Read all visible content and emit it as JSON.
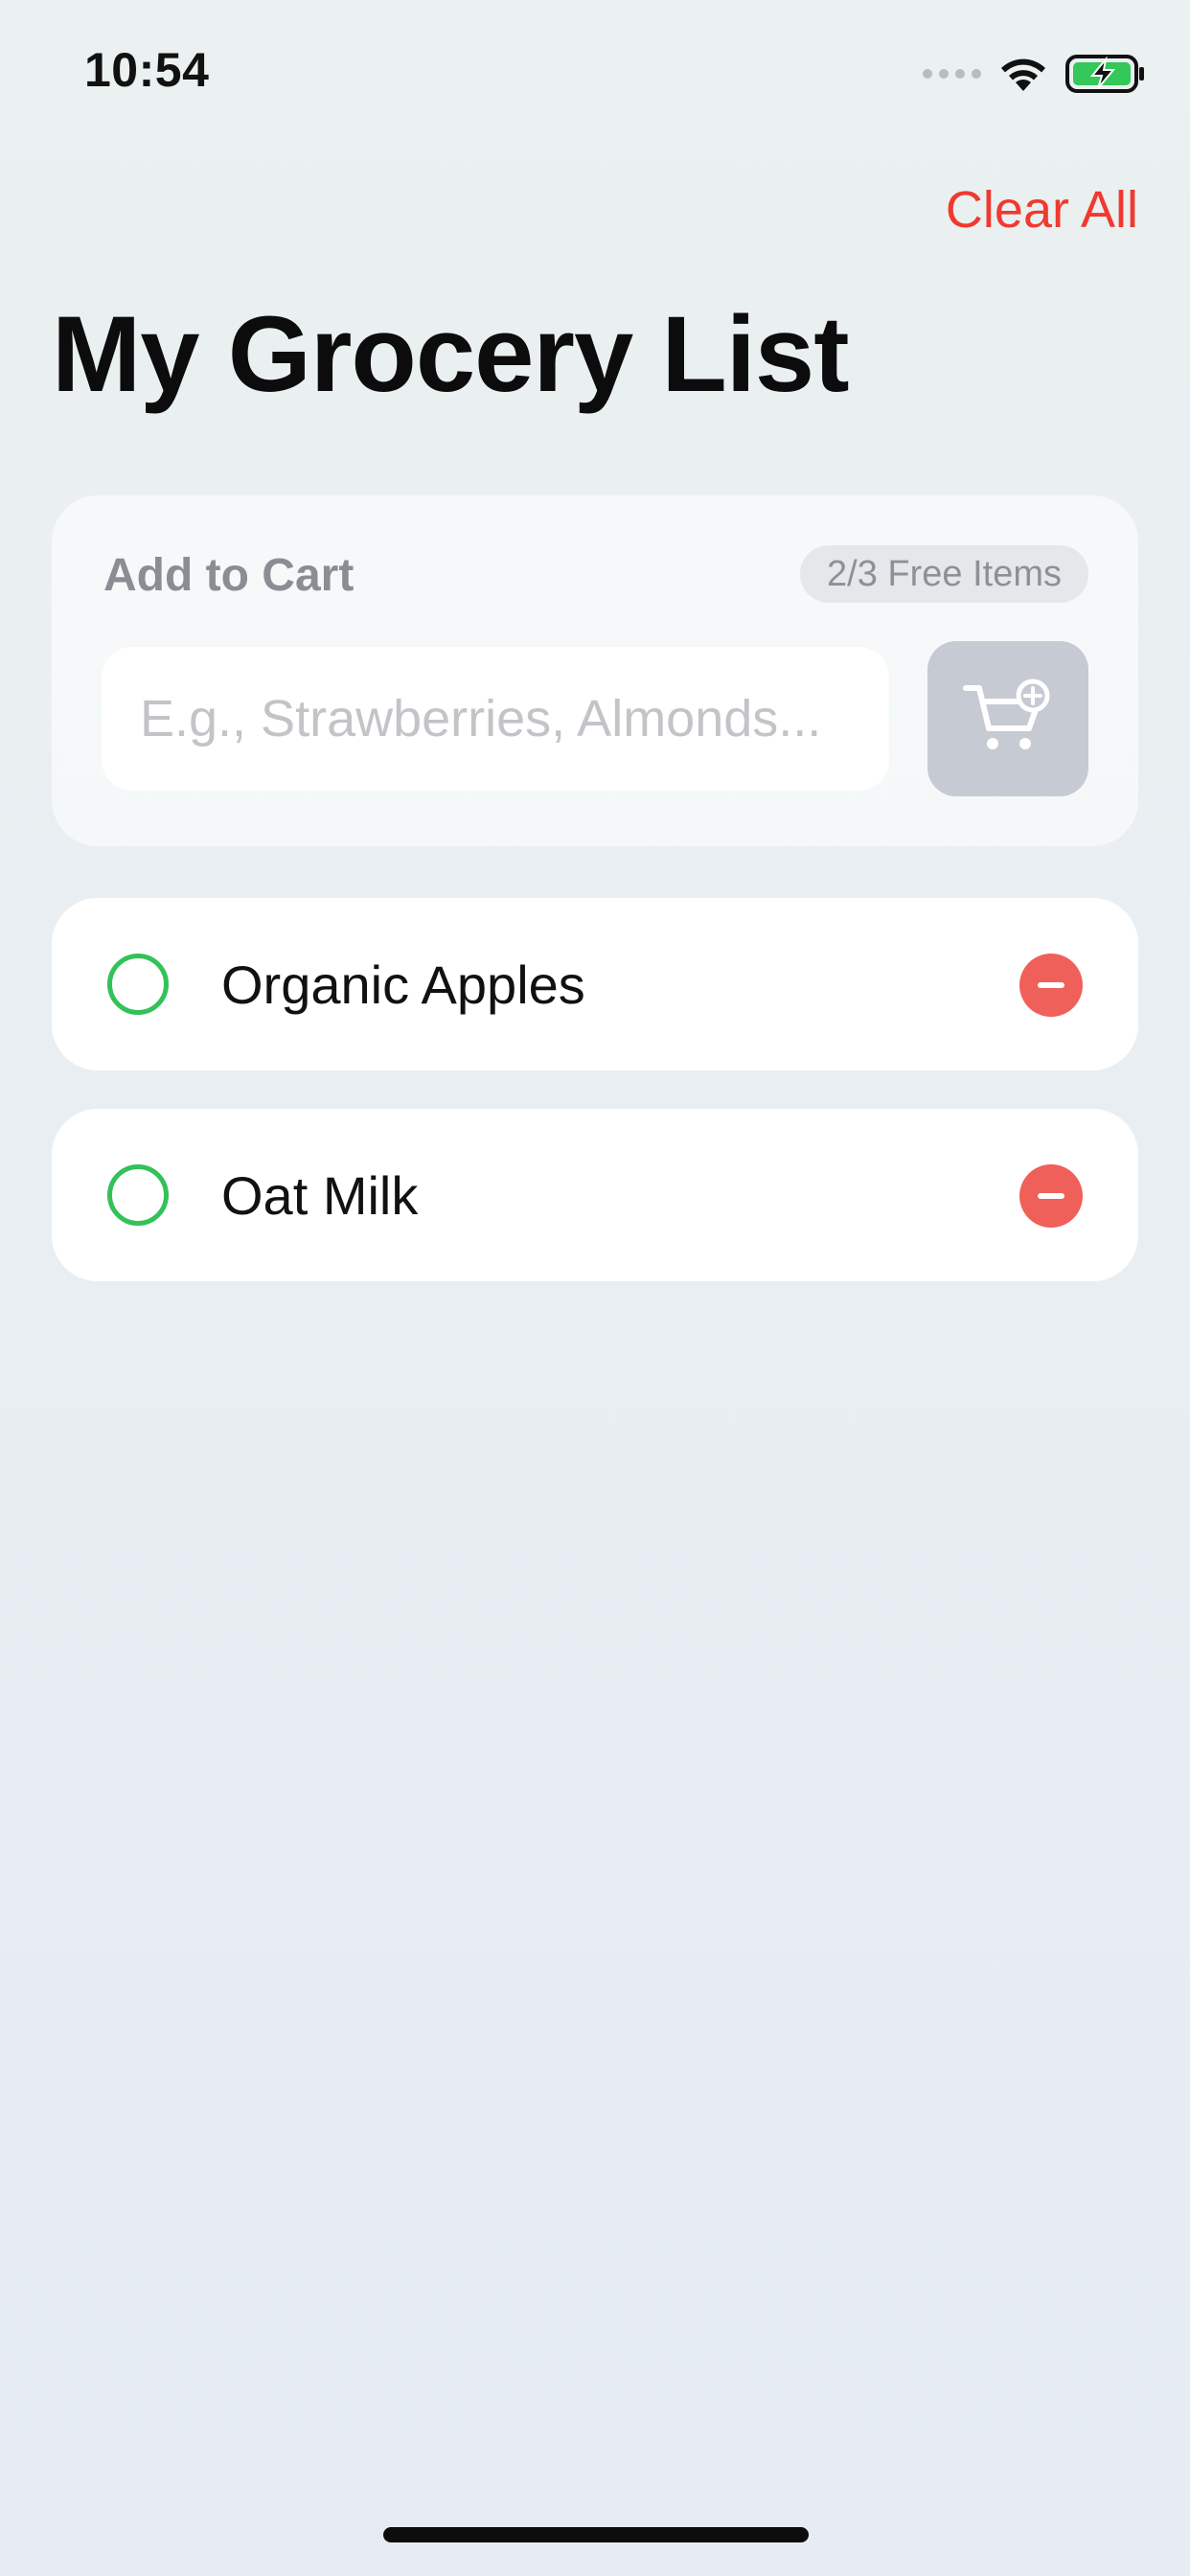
{
  "status_bar": {
    "time": "10:54",
    "icons": [
      "signal-dots-icon",
      "wifi-icon",
      "battery-charging-icon"
    ],
    "battery_color": "#34c759"
  },
  "header": {
    "clear_all_label": "Clear All",
    "title": "My Grocery List"
  },
  "add_card": {
    "label": "Add to Cart",
    "free_items_badge": "2/3 Free Items",
    "input_value": "",
    "input_placeholder": "E.g., Strawberries, Almonds...",
    "add_button_icon": "cart-plus-icon"
  },
  "items": [
    {
      "label": "Organic Apples",
      "checked": false
    },
    {
      "label": "Oat Milk",
      "checked": false
    }
  ],
  "colors": {
    "accent_red": "#f0392f",
    "check_green": "#33c15a",
    "remove_red": "#f0605a"
  }
}
